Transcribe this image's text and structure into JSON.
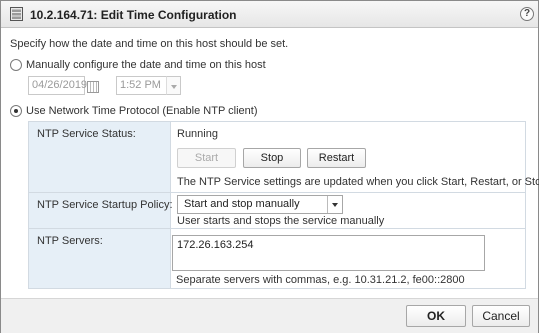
{
  "dialog": {
    "title": "10.2.164.71: Edit Time Configuration",
    "help_label": "?"
  },
  "intro": "Specify how the date and time on this host should be set.",
  "manual": {
    "label": "Manually configure the date and time on this host",
    "selected": false,
    "date_value": "04/26/2019",
    "time_value": "1:52 PM"
  },
  "ntp": {
    "label": "Use Network Time Protocol (Enable NTP client)",
    "selected": true,
    "status_label": "NTP Service Status:",
    "status_value": "Running",
    "start_label": "Start",
    "stop_label": "Stop",
    "restart_label": "Restart",
    "settings_note": "The NTP Service settings are updated when you click Start, Restart, or Stop.",
    "policy_label": "NTP Service Startup Policy:",
    "policy_value": "Start and stop manually",
    "policy_note": "User starts and stops the service manually",
    "servers_label": "NTP Servers:",
    "servers_value": "172.26.163.254",
    "servers_hint": "Separate servers with commas, e.g. 10.31.21.2, fe00::2800"
  },
  "footer": {
    "ok_label": "OK",
    "cancel_label": "Cancel"
  },
  "colors": {
    "label_cell_bg": "#e6eff7",
    "title_bar_bg": "#ececec",
    "footer_bg": "#f0f0f0"
  }
}
